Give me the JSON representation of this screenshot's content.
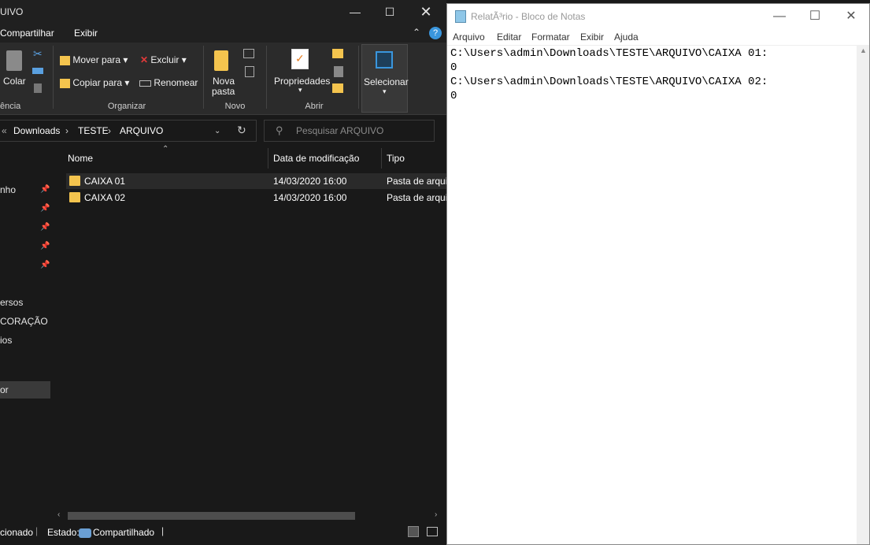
{
  "explorer": {
    "title": "UIVO",
    "ribbon_tabs": [
      "Compartilhar",
      "Exibir"
    ],
    "help_label": "?",
    "ribbon": {
      "colar": "Colar",
      "mover_para": "Mover para",
      "copiar_para": "Copiar para",
      "excluir": "Excluir",
      "renomear": "Renomear",
      "nova_pasta_1": "Nova",
      "nova_pasta_2": "pasta",
      "propriedades": "Propriedades",
      "selecionar": "Selecionar",
      "groups": {
        "area": "ência",
        "organizar": "Organizar",
        "novo": "Novo",
        "abrir": "Abrir"
      }
    },
    "address": {
      "crumbs": [
        "Downloads",
        "TESTE",
        "ARQUIVO"
      ]
    },
    "search_placeholder": "Pesquisar ARQUIVO",
    "nav_items": [
      "nho",
      "ersos",
      "CORAÇÃO",
      "ios",
      "or"
    ],
    "columns": [
      "Nome",
      "Data de modificação",
      "Tipo"
    ],
    "rows": [
      {
        "name": "CAIXA 01",
        "date": "14/03/2020 16:00",
        "type": "Pasta de arqui"
      },
      {
        "name": "CAIXA 02",
        "date": "14/03/2020 16:00",
        "type": "Pasta de arqui"
      }
    ],
    "status": {
      "left": "cionado",
      "estado_label": "Estado:",
      "estado_value": "Compartilhado"
    }
  },
  "notepad": {
    "title": "RelatÃ³rio - Bloco de Notas",
    "menu": [
      "Arquivo",
      "Editar",
      "Formatar",
      "Exibir",
      "Ajuda"
    ],
    "lines": [
      "C:\\Users\\admin\\Downloads\\TESTE\\ARQUIVO\\CAIXA 01:",
      "0",
      "C:\\Users\\admin\\Downloads\\TESTE\\ARQUIVO\\CAIXA 02:",
      "0"
    ]
  },
  "colors": {
    "accent": "#3a96dd",
    "folder": "#f4c44e",
    "dark_bg": "#191919"
  }
}
